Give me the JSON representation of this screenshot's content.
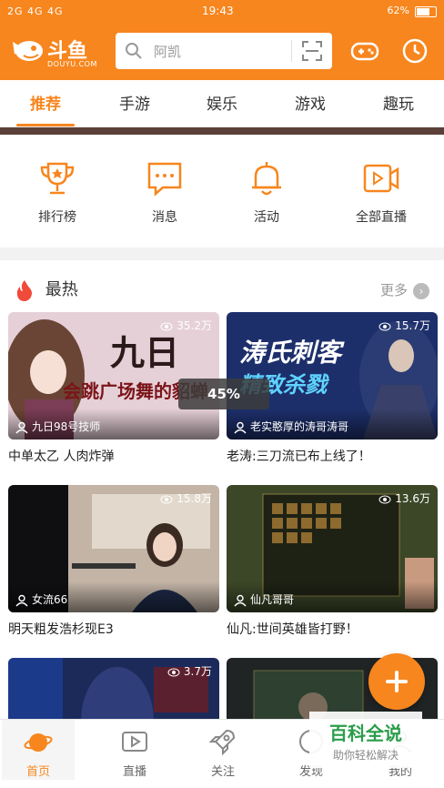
{
  "status": {
    "signal": "2G 4G 4G",
    "time": "19:43",
    "battery": "62%"
  },
  "header": {
    "logo_name": "斗鱼",
    "logo_sub": "DOUYU.COM",
    "search_placeholder": "阿凯",
    "accent": "#f7861e"
  },
  "tabs": [
    "推荐",
    "手游",
    "娱乐",
    "游戏",
    "趣玩"
  ],
  "quick": [
    {
      "label": "排行榜",
      "icon": "trophy-icon"
    },
    {
      "label": "消息",
      "icon": "message-icon"
    },
    {
      "label": "活动",
      "icon": "bell-icon"
    },
    {
      "label": "全部直播",
      "icon": "video-icon"
    }
  ],
  "hot": {
    "title": "最热",
    "more": "更多",
    "cards": [
      {
        "views": "35.2万",
        "anchor": "九日98号技师",
        "title": "中单太乙 人肉炸弹",
        "thumb_text": "九日",
        "thumb_text2": "会跳广场舞的貂蝉",
        "thumb_color": "#e8c7cf"
      },
      {
        "views": "15.7万",
        "anchor": "老实憨厚的涛哥涛哥",
        "title": "老涛:三刀流已布上线了！",
        "thumb_text": "涛氏刺客",
        "thumb_text2": "精致杀戮",
        "thumb_color": "#1e3a78"
      },
      {
        "views": "15.8万",
        "anchor": "女流66",
        "title": "明天粗发浩杉现E3",
        "thumb_color": "#b9a99c"
      },
      {
        "views": "13.6万",
        "anchor": "仙凡哥哥",
        "title": "仙凡:世间英雄皆打野！",
        "thumb_color": "#3f4a2c"
      },
      {
        "views": "3.7万",
        "anchor": "",
        "title": "",
        "thumb_color": "#1c2a5a"
      },
      {
        "views": "",
        "anchor": "",
        "title": "",
        "thumb_color": "#202424"
      }
    ]
  },
  "progress": {
    "value": 0.45,
    "label": "45%"
  },
  "bottom_nav": [
    "首页",
    "直播",
    "关注",
    "发现",
    "我的"
  ],
  "watermark": {
    "line1": "百科全说",
    "line2": "助你轻松解决"
  }
}
